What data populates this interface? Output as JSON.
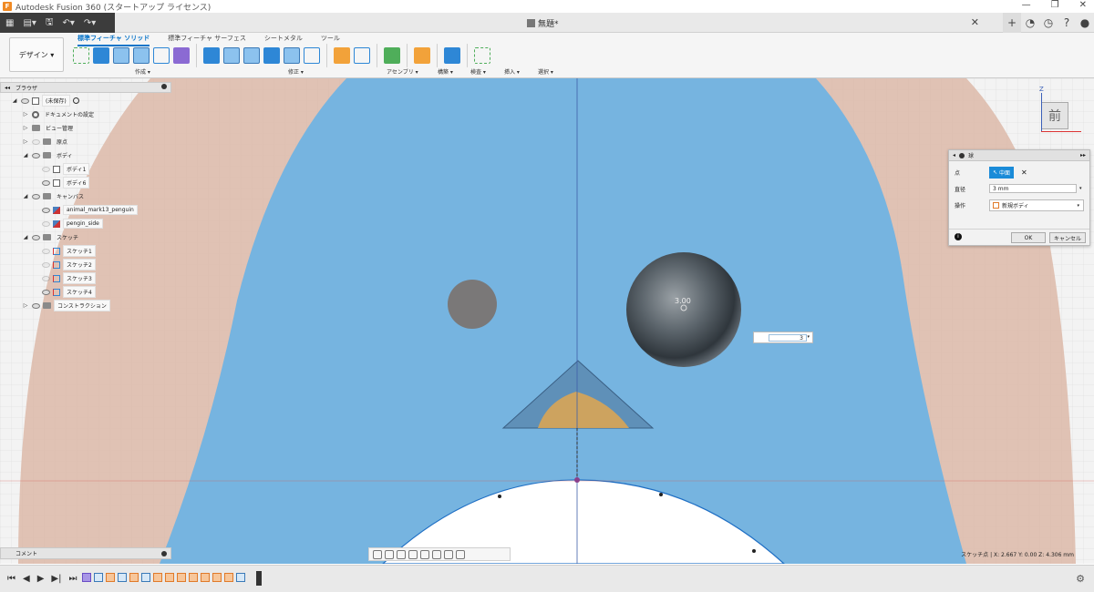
{
  "titlebar": {
    "title": "Autodesk Fusion 360 (スタートアップ ライセンス)"
  },
  "quickbar": {
    "doc_title": "無題*",
    "close": "✕",
    "add": "+"
  },
  "toolbar": {
    "design_label": "デザイン ▾",
    "tabs": [
      "標準フィーチャ ソリッド",
      "標準フィーチャ サーフェス",
      "シートメタル",
      "ツール"
    ],
    "groups": [
      "作成 ▾",
      "修正 ▾",
      "アセンブリ ▾",
      "構築 ▾",
      "検査 ▾",
      "挿入 ▾",
      "選択 ▾"
    ]
  },
  "browser": {
    "title": "ブラウザ",
    "items": [
      {
        "label": "(未保存)",
        "indent": 0,
        "arrow": "◢",
        "icon": "box"
      },
      {
        "label": "ドキュメントの設定",
        "indent": 1,
        "arrow": "▷",
        "icon": "gear"
      },
      {
        "label": "ビュー管理",
        "indent": 1,
        "arrow": "▷",
        "icon": "folder"
      },
      {
        "label": "原点",
        "indent": 1,
        "arrow": "▷",
        "icon": "folder"
      },
      {
        "label": "ボディ",
        "indent": 1,
        "arrow": "◢",
        "icon": "folder"
      },
      {
        "label": "ボディ1",
        "indent": 2,
        "arrow": "",
        "icon": "box"
      },
      {
        "label": "ボディ6",
        "indent": 2,
        "arrow": "",
        "icon": "box"
      },
      {
        "label": "キャンバス",
        "indent": 1,
        "arrow": "◢",
        "icon": "folder"
      },
      {
        "label": "animal_mark13_penguin",
        "indent": 2,
        "arrow": "",
        "icon": "image"
      },
      {
        "label": "pengin_side",
        "indent": 2,
        "arrow": "",
        "icon": "image"
      },
      {
        "label": "スケッチ",
        "indent": 1,
        "arrow": "◢",
        "icon": "folder"
      },
      {
        "label": "スケッチ1",
        "indent": 2,
        "arrow": "",
        "icon": "sketch"
      },
      {
        "label": "スケッチ2",
        "indent": 2,
        "arrow": "",
        "icon": "sketch"
      },
      {
        "label": "スケッチ3",
        "indent": 2,
        "arrow": "",
        "icon": "sketch"
      },
      {
        "label": "スケッチ4",
        "indent": 2,
        "arrow": "",
        "icon": "sketch"
      },
      {
        "label": "コンストラクション",
        "indent": 1,
        "arrow": "▷",
        "icon": "folder"
      }
    ]
  },
  "comment": {
    "label": "コメント"
  },
  "viewcube": {
    "face": "前",
    "axis_z": "Z"
  },
  "sphere_dialog": {
    "title": "球",
    "point_label": "点",
    "point_value": "中面",
    "diameter_label": "直径",
    "diameter_value": "3 mm",
    "operation_label": "操作",
    "operation_value": "新規ボディ",
    "ok": "OK",
    "cancel": "キャンセル"
  },
  "dimension": {
    "sphere_label": "3.00",
    "input_value": "3"
  },
  "status": {
    "text": "スケッチ点 | X: 2.667 Y: 0.00 Z: 4.306 mm"
  },
  "colors": {
    "accent": "#0b75c9",
    "body_blue": "#76b4e0",
    "canvas_pink": "#dcb9a8",
    "beak": "#d9a555"
  }
}
